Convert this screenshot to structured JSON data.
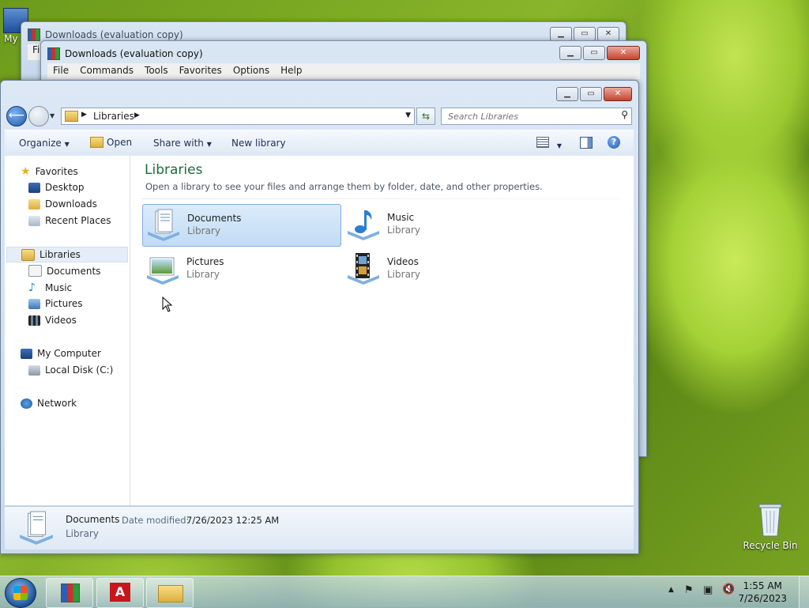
{
  "desktop": {
    "my_computer_label": "My C",
    "recycle_bin_label": "Recycle Bin"
  },
  "bg_windows": [
    {
      "title": "Downloads (evaluation copy)",
      "menu_partial": "Fi"
    },
    {
      "title": "Downloads (evaluation copy)",
      "menu": [
        "File",
        "Commands",
        "Tools",
        "Favorites",
        "Options",
        "Help"
      ]
    }
  ],
  "explorer": {
    "address": "Libraries",
    "search_placeholder": "Search Libraries",
    "toolbar": {
      "organize": "Organize",
      "open": "Open",
      "share_with": "Share with",
      "new_library": "New library"
    },
    "nav": {
      "favorites": "Favorites",
      "desktop": "Desktop",
      "downloads": "Downloads",
      "recent_places": "Recent Places",
      "libraries": "Libraries",
      "documents": "Documents",
      "music": "Music",
      "pictures": "Pictures",
      "videos": "Videos",
      "my_computer": "My Computer",
      "local_disk": "Local Disk (C:)",
      "network": "Network"
    },
    "content": {
      "heading": "Libraries",
      "description": "Open a library to see your files and arrange them by folder, date, and other properties.",
      "libraries": [
        {
          "name": "Documents",
          "type": "Library"
        },
        {
          "name": "Music",
          "type": "Library"
        },
        {
          "name": "Pictures",
          "type": "Library"
        },
        {
          "name": "Videos",
          "type": "Library"
        }
      ]
    },
    "details": {
      "name": "Documents",
      "date_label": "Date modified:",
      "date_value": "7/26/2023 12:25 AM",
      "type": "Library"
    }
  },
  "taskbar": {
    "time": "1:55 AM",
    "date": "7/26/2023"
  },
  "colors": {
    "heading": "#1e6b3a",
    "selection": "#cce4f7",
    "accent": "#2a63b4"
  }
}
